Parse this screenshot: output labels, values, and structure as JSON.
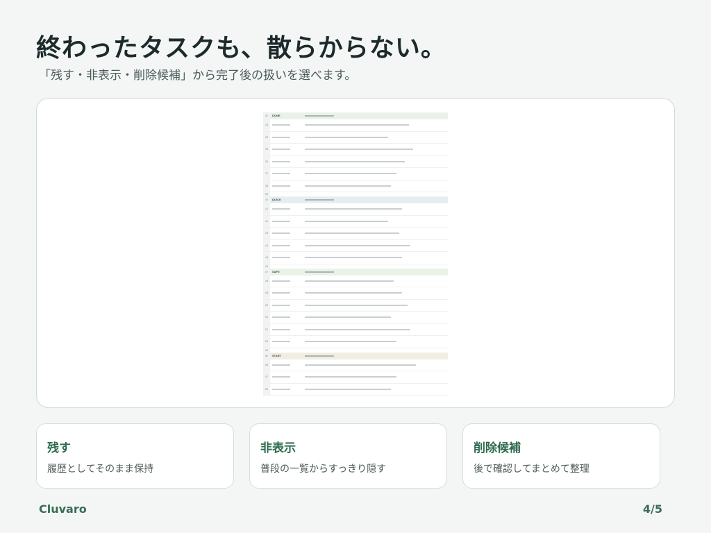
{
  "slide": {
    "headline": "終わったタスクも、散らからない。",
    "subline": "「残す・非表示・削除候補」から完了後の扱いを選べます。"
  },
  "sheet": {
    "sections": [
      {
        "style": "h-done",
        "header": {
          "num": "32",
          "label": "DONE"
        },
        "rows": [
          {
            "num": "33",
            "width": 0.75
          },
          {
            "num": "34",
            "width": 0.6
          },
          {
            "num": "35",
            "width": 0.78
          },
          {
            "num": "36",
            "width": 0.72
          },
          {
            "num": "37",
            "width": 0.66
          },
          {
            "num": "38",
            "width": 0.62
          }
        ],
        "after": [
          "39"
        ]
      },
      {
        "style": "h-quick",
        "header": {
          "num": "40",
          "label": "QUICK"
        },
        "rows": [
          {
            "num": "41",
            "width": 0.7
          },
          {
            "num": "42",
            "width": 0.6
          },
          {
            "num": "43",
            "width": 0.68
          },
          {
            "num": "44",
            "width": 0.76
          },
          {
            "num": "45",
            "width": 0.7
          }
        ],
        "after": [
          "46"
        ]
      },
      {
        "style": "h-safe",
        "header": {
          "num": "47",
          "label": "SAFE"
        },
        "rows": [
          {
            "num": "48",
            "width": 0.64
          },
          {
            "num": "49",
            "width": 0.7
          },
          {
            "num": "50",
            "width": 0.74
          },
          {
            "num": "51",
            "width": 0.62
          },
          {
            "num": "52",
            "width": 0.76
          },
          {
            "num": "53",
            "width": 0.66
          }
        ],
        "after": [
          "54"
        ]
      },
      {
        "style": "h-start",
        "header": {
          "num": "55",
          "label": "START"
        },
        "rows": [
          {
            "num": "56",
            "width": 0.8
          },
          {
            "num": "57",
            "width": 0.66
          },
          {
            "num": "58",
            "width": 0.62
          }
        ],
        "after": []
      }
    ]
  },
  "options": [
    {
      "title": "残す",
      "desc": "履歴としてそのまま保持"
    },
    {
      "title": "非表示",
      "desc": "普段の一覧からすっきり隠す"
    },
    {
      "title": "削除候補",
      "desc": "後で確認してまとめて整理"
    }
  ],
  "footer": {
    "brand": "Cluvaro",
    "page": "4/5"
  }
}
